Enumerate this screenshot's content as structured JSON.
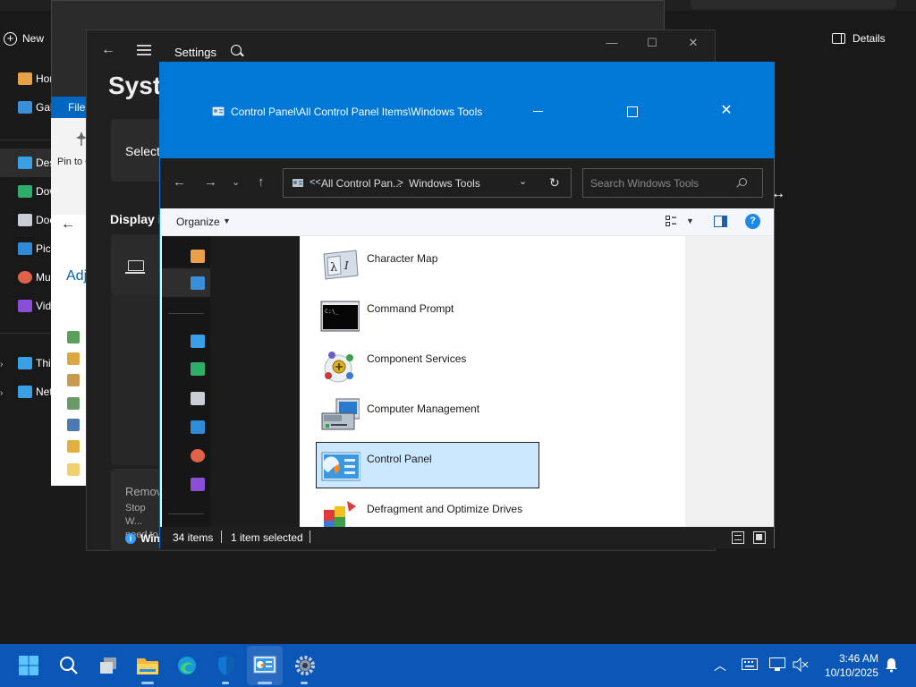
{
  "explorer": {
    "new_label": "New",
    "details_label": "Details",
    "nav_items": [
      {
        "label": "Home"
      },
      {
        "label": "Gallery"
      },
      {
        "label": "Desktop"
      },
      {
        "label": "Downloads"
      },
      {
        "label": "Documents"
      },
      {
        "label": "Pictures"
      },
      {
        "label": "Music"
      },
      {
        "label": "Videos"
      },
      {
        "label": "This PC"
      },
      {
        "label": "Network"
      }
    ]
  },
  "adjust_window": {
    "file_tab": "File",
    "pin_label": "Pin to Quick access",
    "title": "Adjust"
  },
  "settings": {
    "title": "Settings",
    "page_title": "System",
    "select_label": "Select",
    "display_label": "Display information",
    "remove_title": "Remove",
    "remove_desc": "Stop W... need to",
    "info_label": "Win"
  },
  "windows_tools": {
    "title": "Control Panel\\All Control Panel Items\\Windows Tools",
    "address_chevron": "<<",
    "address_crumb1": "All Control Pan...",
    "address_sep": ">",
    "address_crumb2": "Windows Tools",
    "search_placeholder": "Search Windows Tools",
    "organize_label": "Organize",
    "items": [
      {
        "label": "Character Map",
        "icon": "character-map-icon"
      },
      {
        "label": "Command Prompt",
        "icon": "command-prompt-icon"
      },
      {
        "label": "Component Services",
        "icon": "component-services-icon"
      },
      {
        "label": "Computer Management",
        "icon": "computer-management-icon"
      },
      {
        "label": "Control Panel",
        "icon": "control-panel-icon",
        "selected": true
      },
      {
        "label": "Defragment and Optimize Drives",
        "icon": "defragment-icon"
      }
    ],
    "status_count": "34 items",
    "status_selected": "1 item selected"
  },
  "taskbar": {
    "time": "3:46 AM",
    "date": "10/10/2025"
  },
  "colors": {
    "accent": "#0078d7",
    "taskbar": "#0b57b8",
    "selection": "#cce8ff"
  }
}
